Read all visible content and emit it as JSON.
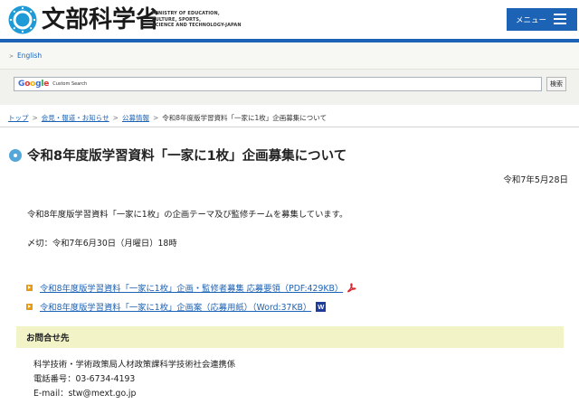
{
  "header": {
    "logo_text": "文部科学省",
    "logo_en": [
      "MINISTRY OF EDUCATION,",
      "CULTURE, SPORTS,",
      "SCIENCE AND TECHNOLOGY-JAPAN"
    ],
    "menu_label": "メニュー"
  },
  "topbar": {
    "english_label": "English"
  },
  "search": {
    "google_label": "Google",
    "custom_search_label": "Custom Search",
    "button_label": "検索"
  },
  "breadcrumbs": {
    "items": [
      "トップ",
      "会見・報道・お知らせ",
      "公募情報"
    ],
    "current": "令和8年度版学習資料「一家に1枚」企画募集について"
  },
  "page": {
    "title": "令和8年度版学習資料「一家に1枚」企画募集について",
    "date": "令和7年5月28日",
    "intro": "令和8年度版学習資料「一家に1枚」の企画テーマ及び監修チームを募集しています。",
    "deadline": "〆切：令和7年6月30日（月曜日）18時",
    "links": [
      {
        "label": "令和8年度版学習資料「一家に1枚」企画・監修者募集 応募要領（PDF:429KB）",
        "file_type": "pdf"
      },
      {
        "label": "令和8年度版学習資料「一家に1枚」企画案（応募用紙）（Word:37KB）",
        "file_type": "word",
        "badge": "W"
      }
    ]
  },
  "contact": {
    "heading": "お問合せ先",
    "lines": [
      "科学技術・学術政策局人材政策課科学技術社会連携係",
      "電話番号：03-6734-4193",
      "E-mail：stw@mext.go.jp"
    ]
  },
  "colors": {
    "brand_blue": "#1d63b5",
    "accent_orange": "#e79b19",
    "contact_bg": "#f2f4c8",
    "title_icon": "#55a7d9"
  }
}
